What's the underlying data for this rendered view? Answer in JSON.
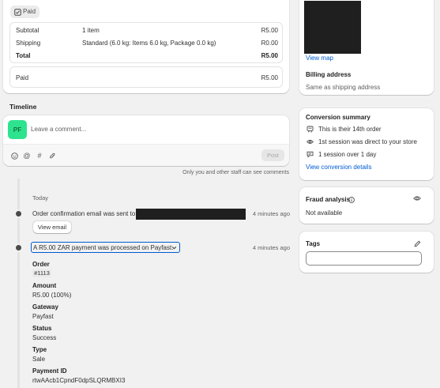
{
  "payment": {
    "badge": "Paid",
    "rows": [
      {
        "label": "Subtotal",
        "desc": "1 item",
        "amount": "R5.00"
      },
      {
        "label": "Shipping",
        "desc": "Standard (6.0 kg: Items 6.0 kg, Package 0.0 kg)",
        "amount": "R0.00"
      },
      {
        "label": "Total",
        "desc": "",
        "amount": "R5.00"
      }
    ],
    "paid_label": "Paid",
    "paid_amount": "R5.00"
  },
  "timeline": {
    "title": "Timeline",
    "avatar_initials": "PF",
    "comment_placeholder": "Leave a comment...",
    "post_label": "Post",
    "staff_note": "Only you and other staff can see comments",
    "date_label": "Today",
    "events": [
      {
        "text": "Order confirmation email was sent to",
        "time": "4 minutes ago",
        "button": "View email"
      },
      {
        "text": "A R5.00 ZAR payment was processed on Payfast.",
        "time": "4 minutes ago"
      }
    ],
    "details": [
      {
        "label": "Order",
        "value": "#1113"
      },
      {
        "label": "Amount",
        "value": "R5.00 (100%)"
      },
      {
        "label": "Gateway",
        "value": "Payfast"
      },
      {
        "label": "Status",
        "value": "Success"
      },
      {
        "label": "Type",
        "value": "Sale"
      },
      {
        "label": "Payment ID",
        "value": "rtwAAcb1CpndF0dpSLQRMBXI3"
      }
    ]
  },
  "address": {
    "view_map": "View map",
    "billing_title": "Billing address",
    "billing_value": "Same as shipping address"
  },
  "conversion": {
    "title": "Conversion summary",
    "items": [
      {
        "icon": "cart-icon",
        "text": "This is their 14th order"
      },
      {
        "icon": "eye-icon",
        "text": "1st session was direct to your store"
      },
      {
        "icon": "chat-icon",
        "text": "1 session over 1 day"
      }
    ],
    "details_link": "View conversion details"
  },
  "fraud": {
    "title": "Fraud analysis",
    "value": "Not available"
  },
  "tags": {
    "title": "Tags"
  },
  "colors": {
    "accent": "#005bd3",
    "avatar_bg": "#2ee38d",
    "page_bg": "#f1f1f1",
    "redacted": "#1f1f1f"
  }
}
